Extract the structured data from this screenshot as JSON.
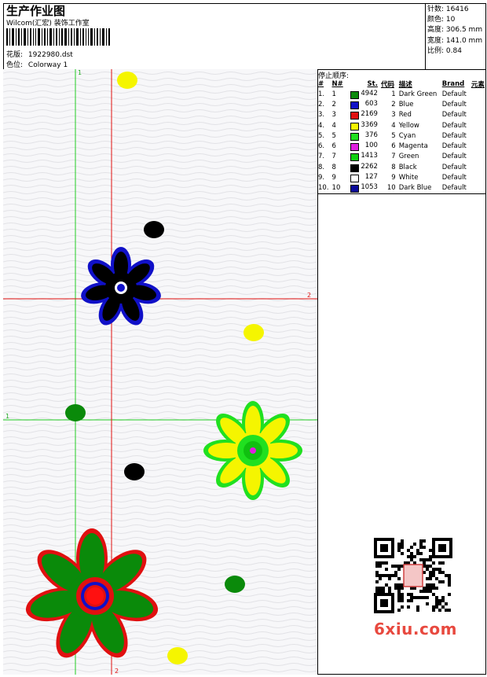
{
  "header": {
    "title": "生产作业图",
    "company": "Wilcom(汇宏) 装饰工作室",
    "design_label": "花版:",
    "design_value": "1922980.dst",
    "colorway_label": "色位:",
    "colorway_value": "Colorway 1"
  },
  "stats": [
    {
      "label": "针数:",
      "value": "16416"
    },
    {
      "label": "颜色:",
      "value": "10"
    },
    {
      "label": "高度:",
      "value": "306.5 mm"
    },
    {
      "label": "宽度:",
      "value": "141.0 mm"
    },
    {
      "label": "比例:",
      "value": "0.84"
    }
  ],
  "stop_sequence": {
    "title": "停止顺序:",
    "columns": [
      "#",
      "N#",
      "St.",
      "代码",
      "描述",
      "Brand",
      "元素"
    ],
    "rows": [
      {
        "idx": "1.",
        "n": "1",
        "st": "4942",
        "code": "1",
        "desc": "Dark Green",
        "brand": "Default",
        "color": "#0a8a0a"
      },
      {
        "idx": "2.",
        "n": "2",
        "st": "603",
        "code": "2",
        "desc": "Blue",
        "brand": "Default",
        "color": "#1010c8"
      },
      {
        "idx": "3.",
        "n": "3",
        "st": "2169",
        "code": "3",
        "desc": "Red",
        "brand": "Default",
        "color": "#e01010"
      },
      {
        "idx": "4.",
        "n": "4",
        "st": "3369",
        "code": "4",
        "desc": "Yellow",
        "brand": "Default",
        "color": "#f5f500"
      },
      {
        "idx": "5.",
        "n": "5",
        "st": "376",
        "code": "5",
        "desc": "Cyan",
        "brand": "Default",
        "color": "#20e020"
      },
      {
        "idx": "6.",
        "n": "6",
        "st": "100",
        "code": "6",
        "desc": "Magenta",
        "brand": "Default",
        "color": "#e020e0"
      },
      {
        "idx": "7.",
        "n": "7",
        "st": "1413",
        "code": "7",
        "desc": "Green",
        "brand": "Default",
        "color": "#10d010"
      },
      {
        "idx": "8.",
        "n": "8",
        "st": "2262",
        "code": "8",
        "desc": "Black",
        "brand": "Default",
        "color": "#000000"
      },
      {
        "idx": "9.",
        "n": "9",
        "st": "127",
        "code": "9",
        "desc": "White",
        "brand": "Default",
        "color": "#ffffff"
      },
      {
        "idx": "10.",
        "n": "10",
        "st": "1053",
        "code": "10",
        "desc": "Dark Blue",
        "brand": "Default",
        "color": "#0a0a9a"
      }
    ]
  },
  "guides": {
    "v1_label": "1",
    "v2_label": "2",
    "h1_label": "1",
    "h2_label": "2"
  },
  "watermark": "6xiu.com"
}
